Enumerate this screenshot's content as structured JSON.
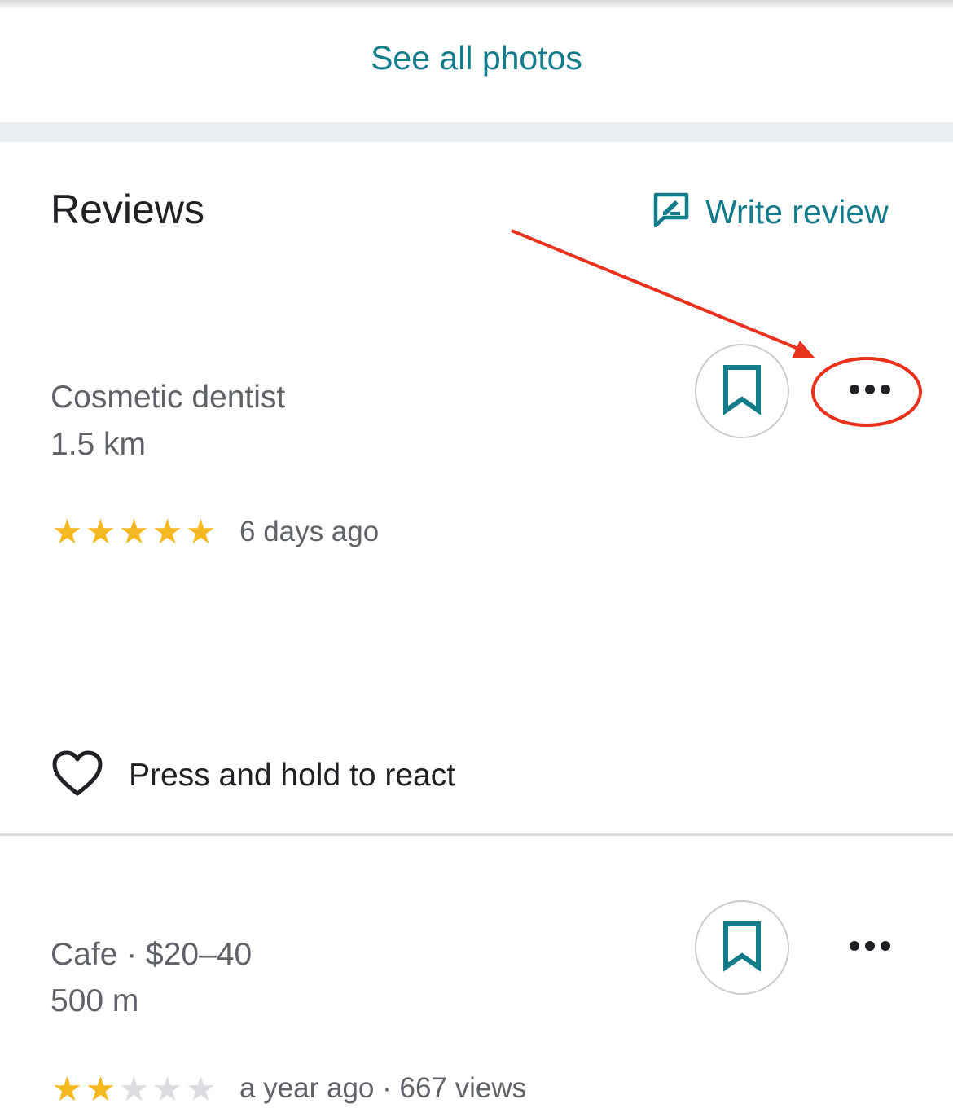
{
  "photos": {
    "see_all_label": "See all photos"
  },
  "reviews": {
    "title": "Reviews",
    "write_review_label": "Write review",
    "items": [
      {
        "place_type": "Cosmetic dentist",
        "distance": "1.5 km",
        "rating": 5,
        "meta": "6 days ago",
        "react_label": "Press and hold to react"
      },
      {
        "place_type": "Cafe · $20–40",
        "distance": "500 m",
        "rating": 2,
        "meta": "a year ago · 667 views"
      }
    ]
  },
  "colors": {
    "accent": "#137b8a",
    "star": "#f6b820",
    "annotation": "#e8321e"
  },
  "icons": {
    "write_review": "edit-review-icon",
    "save": "bookmark-icon",
    "more": "more-horizontal-icon",
    "react": "heart-icon",
    "star": "star-icon"
  }
}
